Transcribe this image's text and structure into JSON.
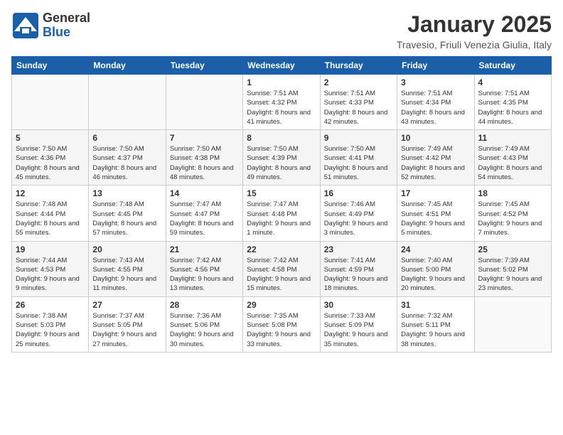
{
  "logo": {
    "general": "General",
    "blue": "Blue"
  },
  "title": "January 2025",
  "location": "Travesio, Friuli Venezia Giulia, Italy",
  "days_of_week": [
    "Sunday",
    "Monday",
    "Tuesday",
    "Wednesday",
    "Thursday",
    "Friday",
    "Saturday"
  ],
  "weeks": [
    [
      {
        "date": "",
        "info": ""
      },
      {
        "date": "",
        "info": ""
      },
      {
        "date": "",
        "info": ""
      },
      {
        "date": "1",
        "info": "Sunrise: 7:51 AM\nSunset: 4:32 PM\nDaylight: 8 hours and 41 minutes."
      },
      {
        "date": "2",
        "info": "Sunrise: 7:51 AM\nSunset: 4:33 PM\nDaylight: 8 hours and 42 minutes."
      },
      {
        "date": "3",
        "info": "Sunrise: 7:51 AM\nSunset: 4:34 PM\nDaylight: 8 hours and 43 minutes."
      },
      {
        "date": "4",
        "info": "Sunrise: 7:51 AM\nSunset: 4:35 PM\nDaylight: 8 hours and 44 minutes."
      }
    ],
    [
      {
        "date": "5",
        "info": "Sunrise: 7:50 AM\nSunset: 4:36 PM\nDaylight: 8 hours and 45 minutes."
      },
      {
        "date": "6",
        "info": "Sunrise: 7:50 AM\nSunset: 4:37 PM\nDaylight: 8 hours and 46 minutes."
      },
      {
        "date": "7",
        "info": "Sunrise: 7:50 AM\nSunset: 4:38 PM\nDaylight: 8 hours and 48 minutes."
      },
      {
        "date": "8",
        "info": "Sunrise: 7:50 AM\nSunset: 4:39 PM\nDaylight: 8 hours and 49 minutes."
      },
      {
        "date": "9",
        "info": "Sunrise: 7:50 AM\nSunset: 4:41 PM\nDaylight: 8 hours and 51 minutes."
      },
      {
        "date": "10",
        "info": "Sunrise: 7:49 AM\nSunset: 4:42 PM\nDaylight: 8 hours and 52 minutes."
      },
      {
        "date": "11",
        "info": "Sunrise: 7:49 AM\nSunset: 4:43 PM\nDaylight: 8 hours and 54 minutes."
      }
    ],
    [
      {
        "date": "12",
        "info": "Sunrise: 7:48 AM\nSunset: 4:44 PM\nDaylight: 8 hours and 55 minutes."
      },
      {
        "date": "13",
        "info": "Sunrise: 7:48 AM\nSunset: 4:45 PM\nDaylight: 8 hours and 57 minutes."
      },
      {
        "date": "14",
        "info": "Sunrise: 7:47 AM\nSunset: 4:47 PM\nDaylight: 8 hours and 59 minutes."
      },
      {
        "date": "15",
        "info": "Sunrise: 7:47 AM\nSunset: 4:48 PM\nDaylight: 9 hours and 1 minute."
      },
      {
        "date": "16",
        "info": "Sunrise: 7:46 AM\nSunset: 4:49 PM\nDaylight: 9 hours and 3 minutes."
      },
      {
        "date": "17",
        "info": "Sunrise: 7:45 AM\nSunset: 4:51 PM\nDaylight: 9 hours and 5 minutes."
      },
      {
        "date": "18",
        "info": "Sunrise: 7:45 AM\nSunset: 4:52 PM\nDaylight: 9 hours and 7 minutes."
      }
    ],
    [
      {
        "date": "19",
        "info": "Sunrise: 7:44 AM\nSunset: 4:53 PM\nDaylight: 9 hours and 9 minutes."
      },
      {
        "date": "20",
        "info": "Sunrise: 7:43 AM\nSunset: 4:55 PM\nDaylight: 9 hours and 11 minutes."
      },
      {
        "date": "21",
        "info": "Sunrise: 7:42 AM\nSunset: 4:56 PM\nDaylight: 9 hours and 13 minutes."
      },
      {
        "date": "22",
        "info": "Sunrise: 7:42 AM\nSunset: 4:58 PM\nDaylight: 9 hours and 15 minutes."
      },
      {
        "date": "23",
        "info": "Sunrise: 7:41 AM\nSunset: 4:59 PM\nDaylight: 9 hours and 18 minutes."
      },
      {
        "date": "24",
        "info": "Sunrise: 7:40 AM\nSunset: 5:00 PM\nDaylight: 9 hours and 20 minutes."
      },
      {
        "date": "25",
        "info": "Sunrise: 7:39 AM\nSunset: 5:02 PM\nDaylight: 9 hours and 23 minutes."
      }
    ],
    [
      {
        "date": "26",
        "info": "Sunrise: 7:38 AM\nSunset: 5:03 PM\nDaylight: 9 hours and 25 minutes."
      },
      {
        "date": "27",
        "info": "Sunrise: 7:37 AM\nSunset: 5:05 PM\nDaylight: 9 hours and 27 minutes."
      },
      {
        "date": "28",
        "info": "Sunrise: 7:36 AM\nSunset: 5:06 PM\nDaylight: 9 hours and 30 minutes."
      },
      {
        "date": "29",
        "info": "Sunrise: 7:35 AM\nSunset: 5:08 PM\nDaylight: 9 hours and 33 minutes."
      },
      {
        "date": "30",
        "info": "Sunrise: 7:33 AM\nSunset: 5:09 PM\nDaylight: 9 hours and 35 minutes."
      },
      {
        "date": "31",
        "info": "Sunrise: 7:32 AM\nSunset: 5:11 PM\nDaylight: 9 hours and 38 minutes."
      },
      {
        "date": "",
        "info": ""
      }
    ]
  ]
}
